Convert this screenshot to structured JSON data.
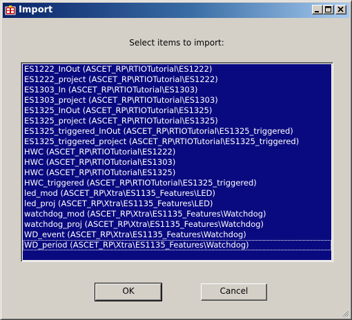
{
  "window": {
    "title": "Import",
    "icon": "import-app-icon",
    "controls": [
      "minimize-icon",
      "maximize-icon",
      "close-icon"
    ]
  },
  "prompt": "Select items to import:",
  "items": [
    "ES1222_InOut (ASCET_RP\\RTIOTutorial\\ES1222)",
    "ES1222_project (ASCET_RP\\RTIOTutorial\\ES1222)",
    "ES1303_In (ASCET_RP\\RTIOTutorial\\ES1303)",
    "ES1303_project (ASCET_RP\\RTIOTutorial\\ES1303)",
    "ES1325_InOut (ASCET_RP\\RTIOTutorial\\ES1325)",
    "ES1325_project (ASCET_RP\\RTIOTutorial\\ES1325)",
    "ES1325_triggered_InOut (ASCET_RP\\RTIOTutorial\\ES1325_triggered)",
    "ES1325_triggered_project (ASCET_RP\\RTIOTutorial\\ES1325_triggered)",
    "HWC (ASCET_RP\\RTIOTutorial\\ES1222)",
    "HWC (ASCET_RP\\RTIOTutorial\\ES1303)",
    "HWC (ASCET_RP\\RTIOTutorial\\ES1325)",
    "HWC_triggered (ASCET_RP\\RTIOTutorial\\ES1325_triggered)",
    "led_mod (ASCET_RP\\Xtra\\ES1135_Features\\LED)",
    "led_proj (ASCET_RP\\Xtra\\ES1135_Features\\LED)",
    "watchdog_mod (ASCET_RP\\Xtra\\ES1135_Features\\Watchdog)",
    "watchdog_proj (ASCET_RP\\Xtra\\ES1135_Features\\Watchdog)",
    "WD_event (ASCET_RP\\Xtra\\ES1135_Features\\Watchdog)",
    "WD_period (ASCET_RP\\Xtra\\ES1135_Features\\Watchdog)"
  ],
  "buttons": {
    "ok": "OK",
    "cancel": "Cancel"
  },
  "colors": {
    "selection": "#0a0a80",
    "title_start": "#0a246a",
    "title_end": "#a6caf0",
    "face": "#d4d0c8"
  }
}
